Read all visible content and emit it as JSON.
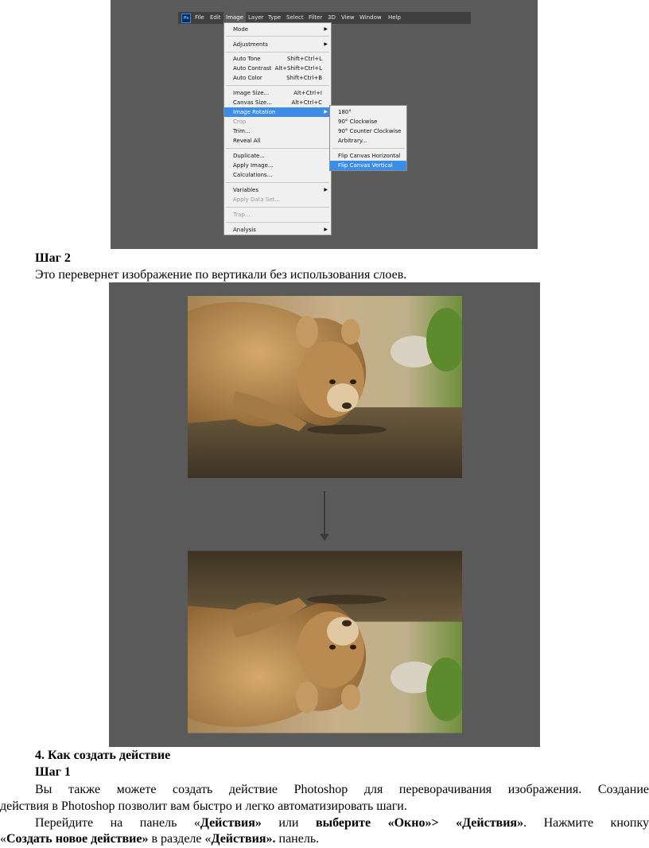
{
  "menubar": {
    "items": [
      "File",
      "Edit",
      "Image",
      "Layer",
      "Type",
      "Select",
      "Filter",
      "3D",
      "View",
      "Window",
      "Help"
    ],
    "logo": "Ps"
  },
  "image_menu": {
    "items": [
      {
        "label": "Mode",
        "submenu": true
      },
      {
        "label": "Adjustments",
        "submenu": true
      },
      {
        "label": "Auto Tone",
        "shortcut": "Shift+Ctrl+L"
      },
      {
        "label": "Auto Contrast",
        "shortcut": "Alt+Shift+Ctrl+L"
      },
      {
        "label": "Auto Color",
        "shortcut": "Shift+Ctrl+B"
      },
      {
        "label": "Image Size...",
        "shortcut": "Alt+Ctrl+I"
      },
      {
        "label": "Canvas Size...",
        "shortcut": "Alt+Ctrl+C"
      },
      {
        "label": "Image Rotation",
        "submenu": true,
        "highlighted": true
      },
      {
        "label": "Crop",
        "disabled": true
      },
      {
        "label": "Trim..."
      },
      {
        "label": "Reveal All"
      },
      {
        "label": "Duplicate..."
      },
      {
        "label": "Apply Image..."
      },
      {
        "label": "Calculations..."
      },
      {
        "label": "Variables",
        "submenu": true
      },
      {
        "label": "Apply Data Set...",
        "disabled": true
      },
      {
        "label": "Trap...",
        "disabled": true
      },
      {
        "label": "Analysis",
        "submenu": true
      }
    ]
  },
  "rotation_menu": {
    "items": [
      {
        "label": "180°"
      },
      {
        "label": "90° Clockwise"
      },
      {
        "label": "90° Counter Clockwise"
      },
      {
        "label": "Arbitrary..."
      },
      {
        "label": "Flip Canvas Horizontal"
      },
      {
        "label": "Flip Canvas Vertical",
        "highlighted": true
      }
    ]
  },
  "step2": {
    "heading": "Шаг 2",
    "text": "Это перевернет изображение по вертикали без использования слоев."
  },
  "section4": {
    "heading": "4.  Как создать действие",
    "step": "Шаг 1",
    "para1_line1": "Вы также можете создать действие Photoshop для переворачивания изображения. Создание",
    "para1_line2": "действия в Photoshop позволит вам быстро и легко автоматизировать шаги.",
    "para2_a": "Перейдите на панель «",
    "para2_b": "Действия»",
    "para2_c": " или ",
    "para2_d": "выберите «Окно»> «Действия»",
    "para2_e": ". Нажмите кнопку",
    "para3_a": "«",
    "para3_b": "Создать новое действие»",
    "para3_c": " в разделе «",
    "para3_d": "Действия».",
    "para3_e": " панель."
  },
  "colors": {
    "highlight": "#3c8de8",
    "panel_gray": "#5a5a5a",
    "menubar": "#3f3f3f"
  }
}
